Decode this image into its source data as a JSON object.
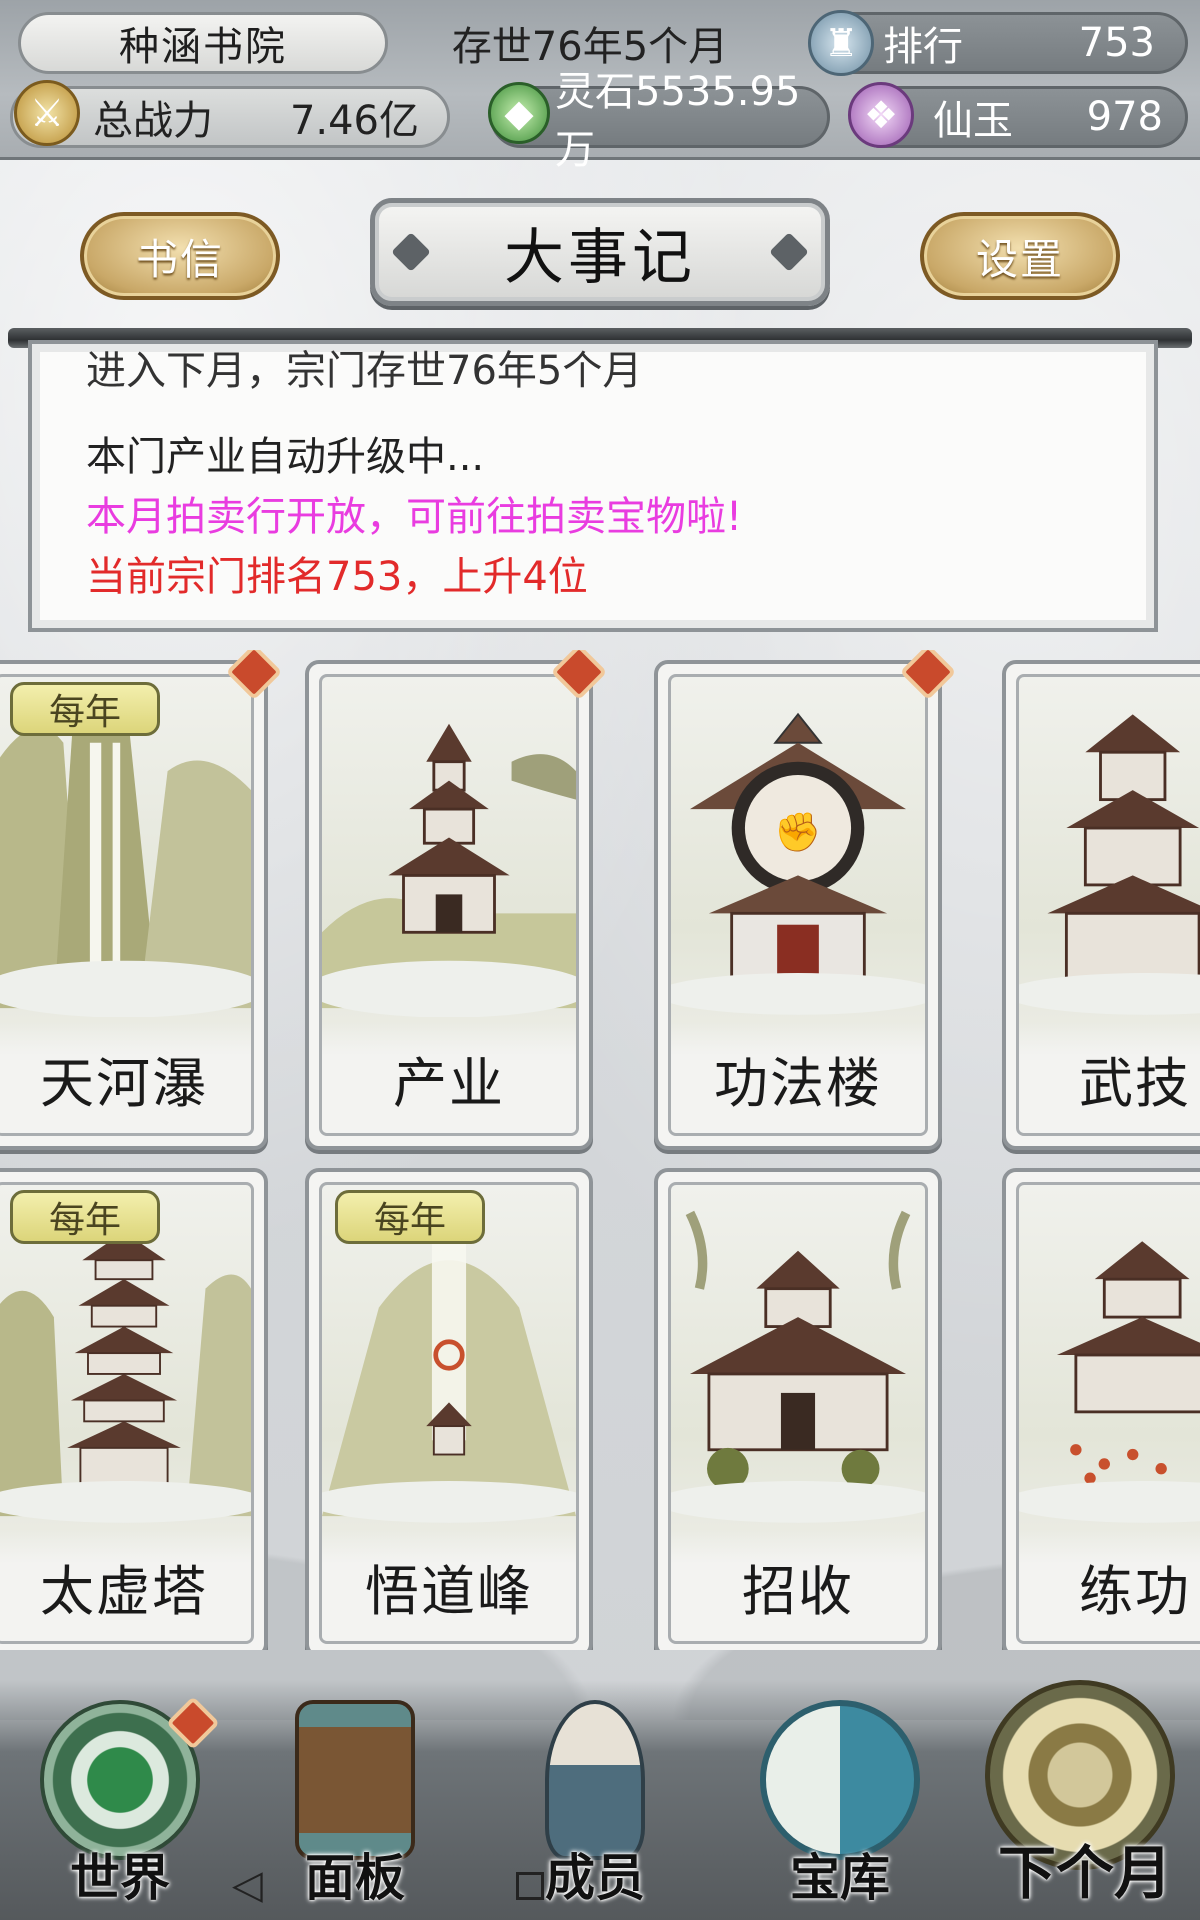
{
  "status": {
    "sect_name": "种涵书院",
    "age": "存世76年5个月",
    "rank_label": "排行",
    "rank_value": "753",
    "power_label": "总战力",
    "power_value": "7.46亿",
    "spirit_stone": "灵石5535.95万",
    "jade_label": "仙玉",
    "jade_value": "978"
  },
  "header": {
    "letter_button": "书信",
    "title": "大事记",
    "settings_button": "设置"
  },
  "log": {
    "cut_line": "进入下月，宗门存世76年5个月",
    "lines": [
      "本门产业自动升级中...",
      "本月拍卖行开放，可前往拍卖宝物啦!",
      "当前宗门排名753，上升4位"
    ]
  },
  "cards": [
    {
      "label": "天河瀑",
      "badge": "每年"
    },
    {
      "label": "产业"
    },
    {
      "label": "功法楼"
    },
    {
      "label": "武技"
    },
    {
      "label": "太虚塔",
      "badge": "每年"
    },
    {
      "label": "悟道峰",
      "badge": "每年"
    },
    {
      "label": "招收"
    },
    {
      "label": "练功"
    }
  ],
  "nav": [
    {
      "label": "世界",
      "icon": "world-orb-icon"
    },
    {
      "label": "面板",
      "icon": "scroll-icon"
    },
    {
      "label": "成员",
      "icon": "member-icon"
    },
    {
      "label": "宝库",
      "icon": "yin-yang-icon"
    },
    {
      "label": "下个月",
      "icon": "next-month-icon"
    }
  ],
  "colors": {
    "log_highlight": "#e93ce0",
    "log_alert": "#e22a2a",
    "gold_button": "#c9a868",
    "red_dot": "#c94a2c"
  }
}
